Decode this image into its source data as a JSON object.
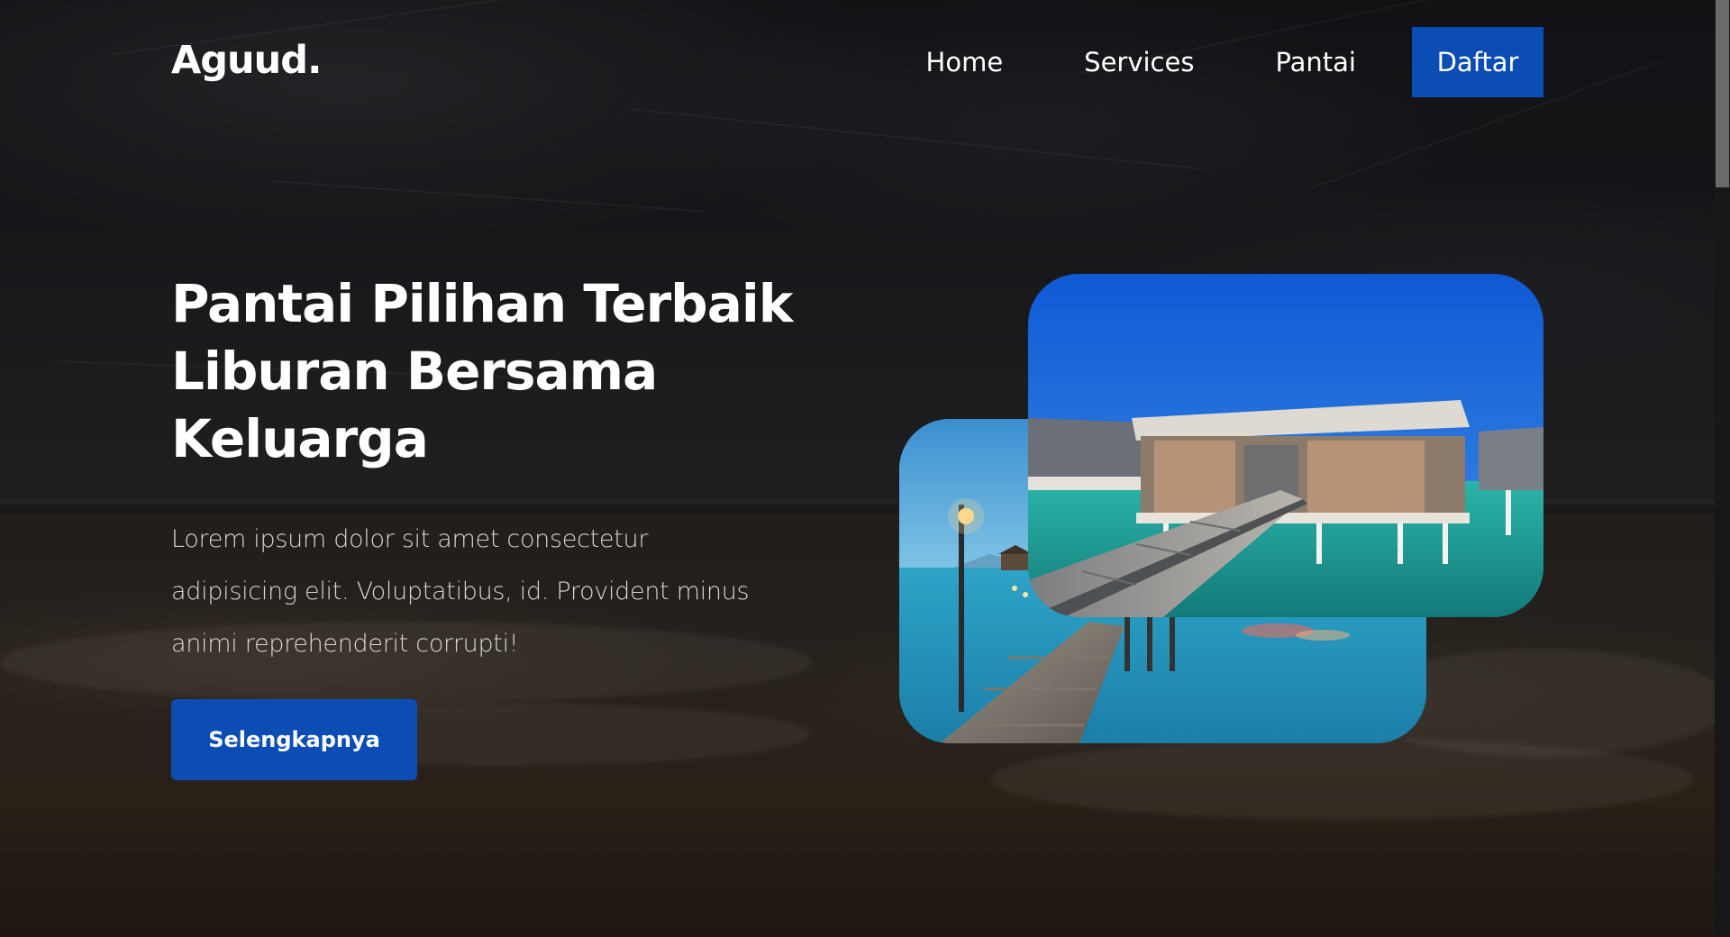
{
  "nav": {
    "brand": "Aguud.",
    "links": [
      {
        "label": "Home"
      },
      {
        "label": "Services"
      },
      {
        "label": "Pantai"
      }
    ],
    "cta_label": "Daftar"
  },
  "hero": {
    "title_lines": [
      "Pantai Pilihan Terbaik",
      "Liburan Bersama",
      "Keluarga"
    ],
    "description_lines": [
      "Lorem ipsum dolor sit amet consectetur",
      "adipisicing elit. Voluptatibus, id. Provident minus",
      "animi reprehenderit corrupti!"
    ],
    "button_label": "Selengkapnya"
  },
  "colors": {
    "accent": "#0b4db5",
    "text": "#ffffff",
    "muted_text": "#d9d6d2"
  },
  "images": [
    {
      "name": "overwater-boardwalk-lamp-photo"
    },
    {
      "name": "overwater-villa-pier-photo"
    }
  ]
}
